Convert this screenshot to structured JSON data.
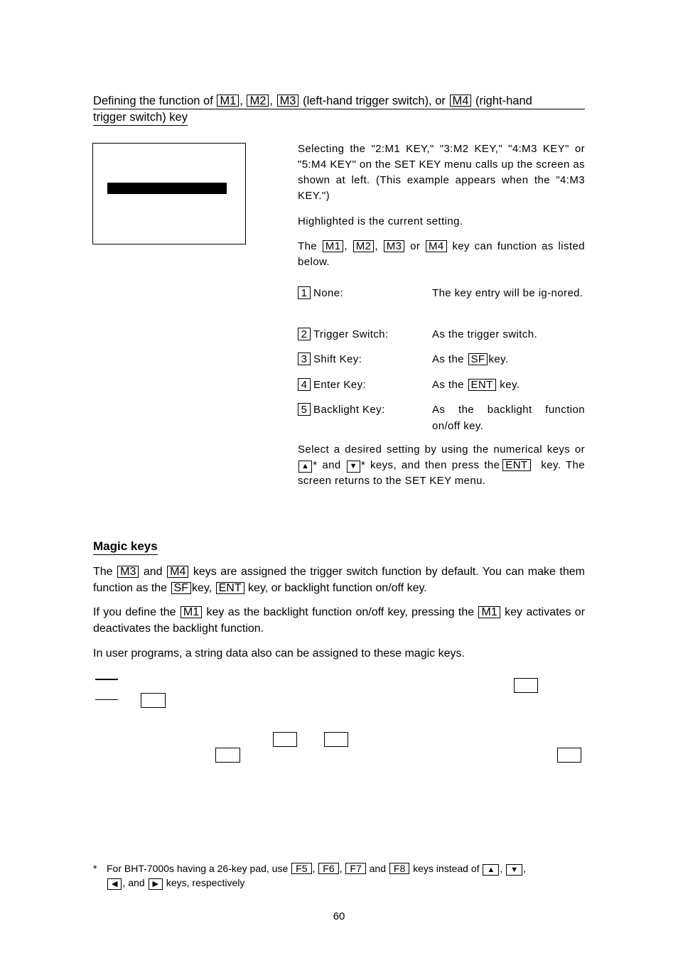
{
  "section_title": {
    "prefix": "Defining the function of",
    "keys": [
      "M1",
      "M2",
      "M3",
      "M4"
    ],
    "mid": "(left-hand trigger switch), or",
    "suffix_line1": "(right-hand",
    "line2": "trigger switch) key"
  },
  "screen": {
    "highlighted_row": "current setting"
  },
  "intro": {
    "p1": "Selecting the \"2:M1 KEY,\" \"3:M2 KEY,\" \"4:M3 KEY\" or \"5:M4 KEY\" on the SET KEY menu calls up the screen as shown at left.  (This example appears when the \"4:M3 KEY.\")",
    "p2": "Highlighted is the current setting.",
    "p3_the": "The",
    "p3_keys": [
      "M1",
      "M2",
      "M3",
      "M4"
    ],
    "p3_or": "or",
    "p3_rest": "key can function as listed below."
  },
  "options": [
    {
      "num": "1",
      "label": "None:",
      "desc": "The key entry will be ig-nored."
    },
    {
      "num": "2",
      "label": "Trigger Switch:",
      "desc": "As the trigger switch."
    },
    {
      "num": "3",
      "label": "Shift Key:",
      "desc_pre": "As the",
      "desc_key": "SF",
      "desc_post": "key."
    },
    {
      "num": "4",
      "label": "Enter Key:",
      "desc_pre": "As the",
      "desc_key": "ENT",
      "desc_post": "key."
    },
    {
      "num": "5",
      "label": "Backlight Key:",
      "desc": "As the backlight function on/off key."
    }
  ],
  "select_para": {
    "t1": "Select a desired setting by using the numerical keys or",
    "up_key": "▲",
    "t2": "* and",
    "down_key": "▼",
    "t3": "* keys, and then press the",
    "ent_key": "ENT",
    "t4": "key.  The screen returns to the SET KEY menu."
  },
  "magic": {
    "title": "Magic keys",
    "p1_a": "The",
    "p1_k1": "M3",
    "p1_b": "and",
    "p1_k2": "M4",
    "p1_c": "keys are assigned the trigger switch function by default.  You can make them function as the",
    "p1_k3": "SF",
    "p1_d": "key,",
    "p1_k4": "ENT",
    "p1_e": "key, or backlight function on/off key.",
    "p2_a": "If you define the",
    "p2_k1": "M1",
    "p2_b": "key as the backlight function on/off key, pressing the",
    "p2_k2": "M1",
    "p2_c": "key activates or deactivates the backlight function.",
    "p3": "In user programs, a string data also can be assigned to these magic keys."
  },
  "footnote": {
    "star": "*",
    "a": "For BHT-7000s having a 26-key pad, use",
    "keys": [
      "F5",
      "F6",
      "F7",
      "F8"
    ],
    "and": "and",
    "b": "keys instead of",
    "arrows": [
      "▲",
      "▼",
      "◀",
      "▶"
    ],
    "c": ", and",
    "d": "keys, respectively"
  },
  "page_number": "60"
}
